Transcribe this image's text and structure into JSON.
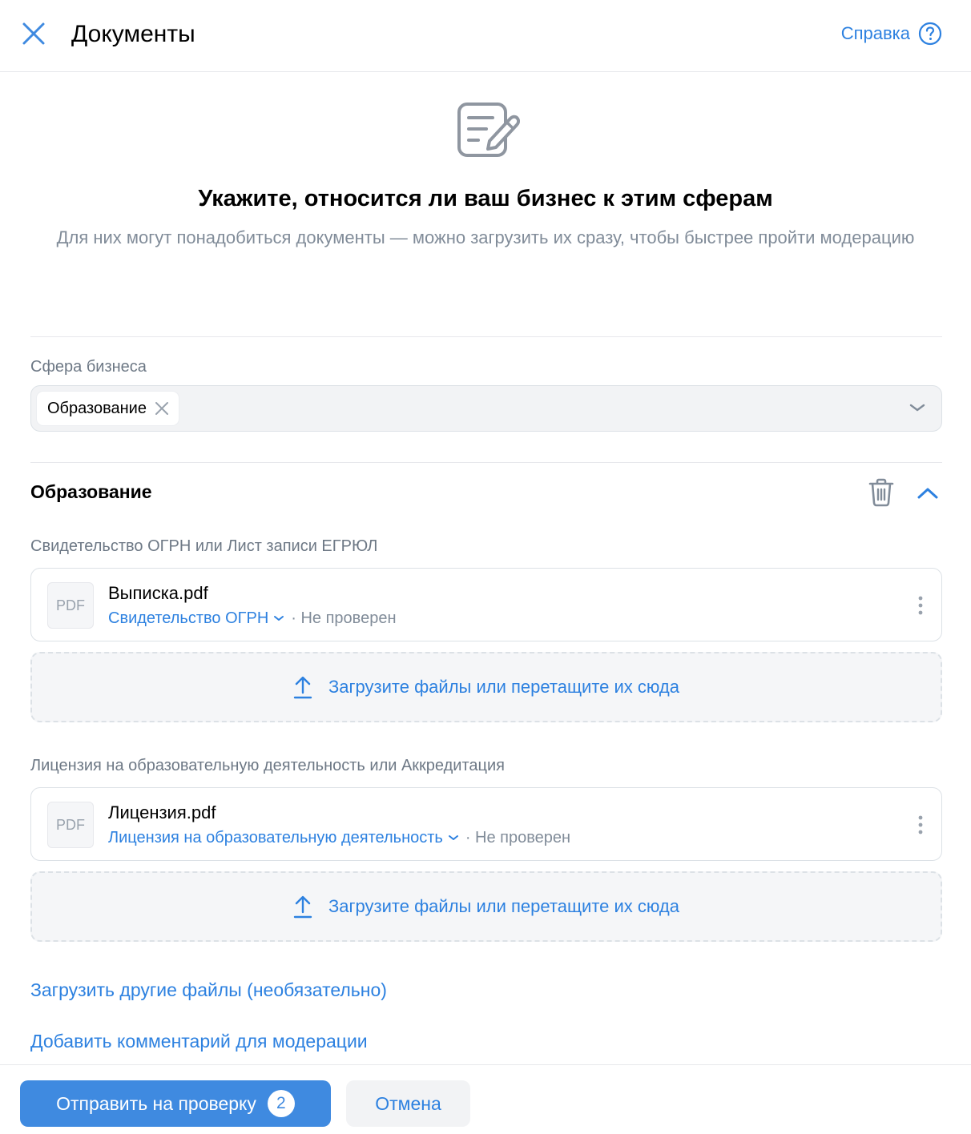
{
  "header": {
    "title": "Документы",
    "help_label": "Справка",
    "close_icon": "close-icon",
    "help_icon": "question-circle-icon"
  },
  "hero": {
    "icon": "document-edit-icon",
    "title": "Укажите, относится ли ваш бизнес к этим сферам",
    "subtitle": "Для них могут понадобиться документы — можно загрузить их сразу,  чтобы быстрее пройти модерацию"
  },
  "business_field": {
    "label": "Сфера бизнеса",
    "selected": [
      "Образование"
    ]
  },
  "section": {
    "title": "Образование",
    "documents": [
      {
        "label": "Свидетельство ОГРН или Лист записи ЕГРЮЛ",
        "file": {
          "thumb": "PDF",
          "name": "Выписка.pdf",
          "type": "Свидетельство ОГРН",
          "status": "· Не проверен"
        },
        "upload_label": "Загрузите файлы или перетащите их сюда"
      },
      {
        "label": "Лицензия на образовательную деятельность или Аккредитация",
        "file": {
          "thumb": "PDF",
          "name": "Лицензия.pdf",
          "type": "Лицензия на образовательную деятельность",
          "status": "· Не проверен"
        },
        "upload_label": "Загрузите файлы или перетащите их сюда"
      }
    ]
  },
  "links": {
    "other_files": "Загрузить другие файлы (необязательно)",
    "add_comment": "Добавить комментарий для модерации"
  },
  "footer": {
    "submit_label": "Отправить на проверку",
    "submit_badge": "2",
    "cancel_label": "Отмена"
  },
  "colors": {
    "accent": "#2d81e0",
    "primary_button": "#3f8ae0",
    "secondary_text": "#818c99"
  }
}
